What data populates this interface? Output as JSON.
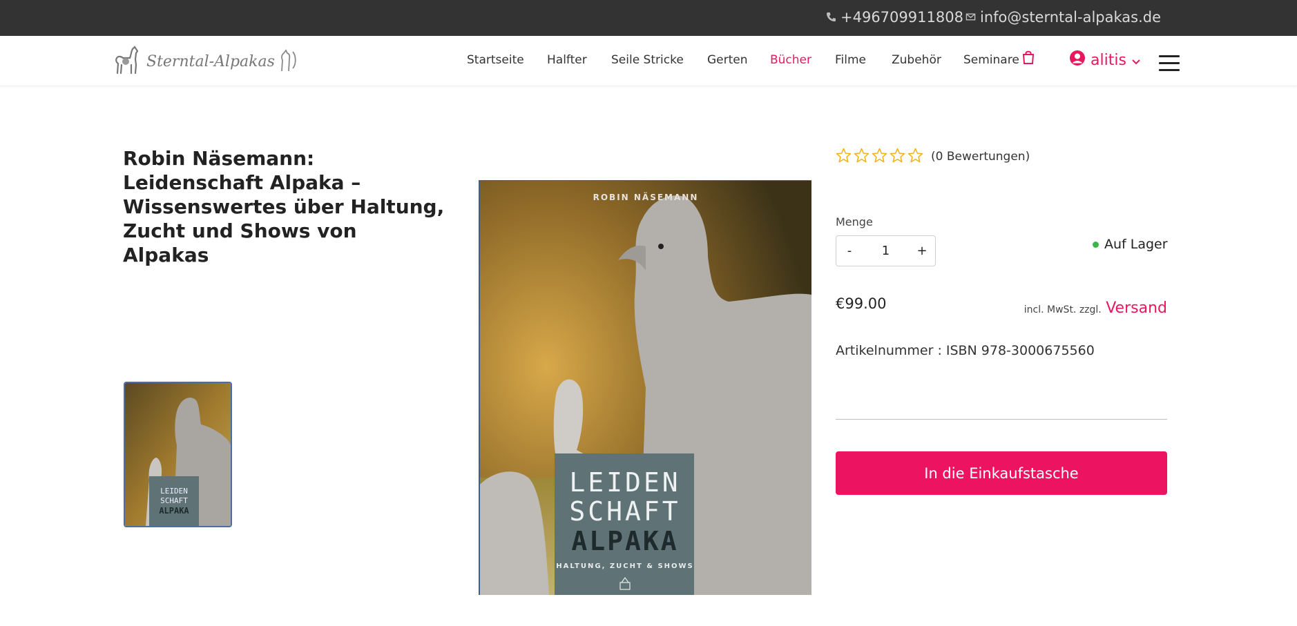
{
  "topbar": {
    "phone": "+496709911808",
    "email": "info@sterntal-alpakas.de"
  },
  "header": {
    "logo_text": "Sterntal-Alpakas",
    "nav": [
      {
        "label": "Startseite"
      },
      {
        "label": "Halfter"
      },
      {
        "label": "Seile Stricke"
      },
      {
        "label": "Gerten"
      },
      {
        "label": "Bücher"
      },
      {
        "label": "Filme"
      },
      {
        "label": "Zubehör"
      },
      {
        "label": "Seminare"
      }
    ],
    "active_nav": "Bücher",
    "user_name": "alitis"
  },
  "product": {
    "title": "Robin Näsemann: Leidenschaft Alpaka – Wissenswertes über Haltung, Zucht und Shows von Alpakas",
    "cover": {
      "author": "ROBIN NÄSEMANN",
      "line1": "LEIDEN",
      "line2": "SCHAFT",
      "line3": "ALPAKA",
      "subtitle": "HALTUNG, ZUCHT & SHOWS"
    },
    "rating_stars": 0,
    "rating_count": "(0 Bewertungen)",
    "quantity_label": "Menge",
    "quantity_minus": "-",
    "quantity_value": "1",
    "quantity_plus": "+",
    "stock": "Auf Lager",
    "price": "€99.00",
    "tax_note": "incl. MwSt. zzgl.",
    "shipping_link": "Versand",
    "sku_label": "Artikelnummer",
    "sku_sep": ":",
    "sku_value": "ISBN 978-3000675560",
    "add_to_cart": "In die Einkaufstasche"
  },
  "colors": {
    "accent": "#ec1460",
    "topbar": "#333333",
    "stock_dot": "#3ab54a",
    "star": "#f2b01e"
  }
}
